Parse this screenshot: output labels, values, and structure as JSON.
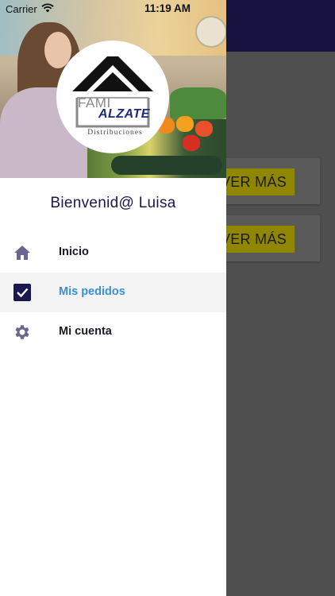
{
  "status_bar": {
    "carrier": "Carrier",
    "time": "11:19 AM",
    "wifi_icon": "wifi-icon"
  },
  "background": {
    "header_color": "#17123f",
    "cards": [
      {
        "button_label": "VER MÁS"
      },
      {
        "button_label": "VER MÁS"
      }
    ],
    "button_color": "#f2e600"
  },
  "drawer": {
    "logo": {
      "line1": "FAMI",
      "line2": "ALZATE",
      "line3": "Distribuciones"
    },
    "welcome": "Bienvenid@ Luisa",
    "menu": [
      {
        "label": "Inicio",
        "icon": "home-icon",
        "active": false
      },
      {
        "label": "Mis pedidos",
        "icon": "checkbox-icon",
        "active": true
      },
      {
        "label": "Mi cuenta",
        "icon": "gear-icon",
        "active": false
      }
    ],
    "accent_color": "#3a8fd6",
    "title_color": "#1a1650"
  }
}
